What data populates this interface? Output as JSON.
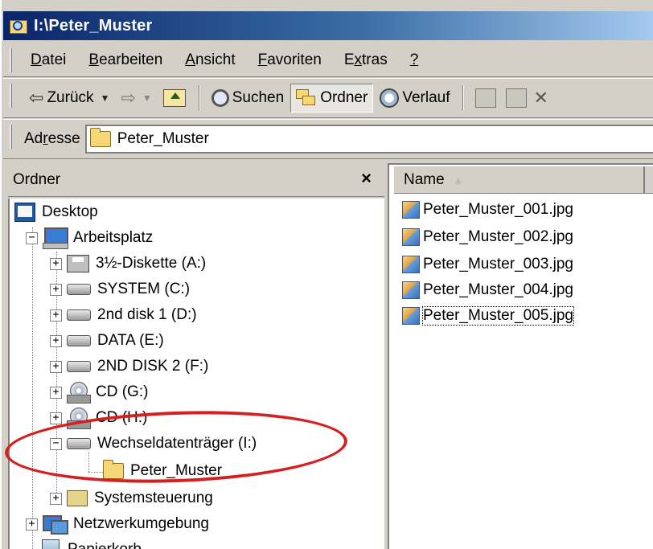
{
  "window": {
    "title": "I:\\Peter_Muster"
  },
  "menu": {
    "datei": {
      "underline": "D",
      "rest": "atei"
    },
    "bearbeiten": {
      "underline": "B",
      "rest": "earbeiten"
    },
    "ansicht": {
      "underline": "A",
      "rest": "nsicht"
    },
    "favoriten": {
      "underline": "F",
      "rest": "avoriten"
    },
    "extras": {
      "pre": "E",
      "underline": "x",
      "rest": "tras"
    },
    "help": {
      "underline": "?"
    }
  },
  "toolbar": {
    "back_label": "Zurück",
    "search_label": "Suchen",
    "folders_label": "Ordner",
    "history_label": "Verlauf"
  },
  "address": {
    "label_pre": "Ad",
    "label_underline": "r",
    "label_rest": "esse",
    "value": "Peter_Muster"
  },
  "folder_pane": {
    "title": "Ordner",
    "close_glyph": "×"
  },
  "tree": {
    "desktop": "Desktop",
    "my_computer": "Arbeitsplatz",
    "drives": [
      {
        "label": "3½-Diskette (A:)"
      },
      {
        "label": "SYSTEM (C:)"
      },
      {
        "label": "2nd disk 1 (D:)"
      },
      {
        "label": "DATA (E:)"
      },
      {
        "label": "2ND DISK 2 (F:)"
      },
      {
        "label": "CD (G:)"
      },
      {
        "label": "CD (H:)"
      },
      {
        "label": "Wechseldatenträger (I:)"
      }
    ],
    "selected_subfolder": "Peter_Muster",
    "control_panel": "Systemsteuerung",
    "network": "Netzwerkumgebung",
    "recycle_bin": "Papierkorb"
  },
  "file_list": {
    "column_name": "Name",
    "sort_indicator": "▲",
    "files": [
      {
        "name": "Peter_Muster_001.jpg"
      },
      {
        "name": "Peter_Muster_002.jpg"
      },
      {
        "name": "Peter_Muster_003.jpg"
      },
      {
        "name": "Peter_Muster_004.jpg"
      },
      {
        "name": "Peter_Muster_005.jpg"
      }
    ]
  },
  "annotation": {
    "ellipse_color": "#d42020"
  }
}
